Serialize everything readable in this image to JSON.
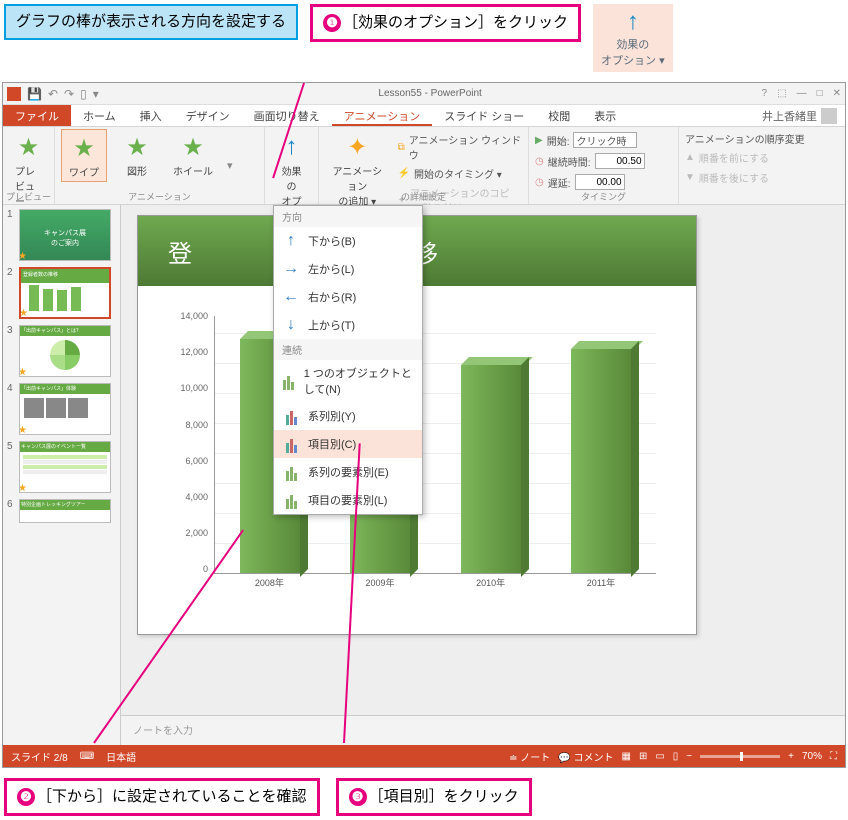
{
  "instructions": {
    "blue": "グラフの棒が表示される方向を設定する",
    "step1": "［効果のオプション］をクリック",
    "step2": "［下から］に設定されていることを確認",
    "step3": "［項目別］をクリック",
    "badge_label": "効果の\nオプション ▾"
  },
  "titlebar": {
    "doc": "Lesson55 - PowerPoint"
  },
  "tabs": {
    "file": "ファイル",
    "home": "ホーム",
    "insert": "挿入",
    "design": "デザイン",
    "transitions": "画面切り替え",
    "animations": "アニメーション",
    "slideshow": "スライド ショー",
    "review": "校閲",
    "view": "表示",
    "user": "井上香緒里"
  },
  "ribbon": {
    "preview": "プレビュー",
    "preview_group": "プレビュー",
    "anim_wipe": "ワイプ",
    "anim_shape": "図形",
    "anim_wheel": "ホイール",
    "anim_group": "アニメーション",
    "effect_options": "効果の\nオプション ▾",
    "add_animation": "アニメーション\nの追加 ▾",
    "anim_pane": "アニメーション ウィンドウ",
    "trigger": "開始のタイミング ▾",
    "painter": "アニメーションのコピー/貼り付け",
    "advanced_group": "の詳細設定",
    "start_label": "開始:",
    "start_value": "クリック時",
    "duration_label": "継続時間:",
    "duration_value": "00.50",
    "delay_label": "遅延:",
    "delay_value": "00.00",
    "reorder_label": "アニメーションの順序変更",
    "move_earlier": "順番を前にする",
    "move_later": "順番を後にする",
    "timing_group": "タイミング"
  },
  "dropdown": {
    "section_direction": "方向",
    "from_bottom": "下から(B)",
    "from_left": "左から(L)",
    "from_right": "右から(R)",
    "from_top": "上から(T)",
    "section_sequence": "連続",
    "as_one": "1 つのオブジェクトとして(N)",
    "by_series": "系列別(Y)",
    "by_category": "項目別(C)",
    "by_series_elem": "系列の要素別(E)",
    "by_category_elem": "項目の要素別(L)"
  },
  "slide": {
    "title_partial_left": "登",
    "title_partial_right": "推移"
  },
  "chart_data": {
    "type": "bar",
    "categories": [
      "2008年",
      "2009年",
      "2010年",
      "2011年"
    ],
    "values": [
      12800,
      11600,
      11300,
      12200
    ],
    "ylim": [
      0,
      14000
    ],
    "yticks": [
      0,
      2000,
      4000,
      6000,
      8000,
      10000,
      12000,
      14000
    ],
    "ytick_labels": [
      "0",
      "2,000",
      "4,000",
      "6,000",
      "8,000",
      "10,000",
      "12,000",
      "14,000"
    ]
  },
  "notes": {
    "placeholder": "ノートを入力"
  },
  "status": {
    "slide": "スライド 2/8",
    "lang": "日本語",
    "notes_btn": "ノート",
    "comments_btn": "コメント",
    "zoom": "70%"
  }
}
